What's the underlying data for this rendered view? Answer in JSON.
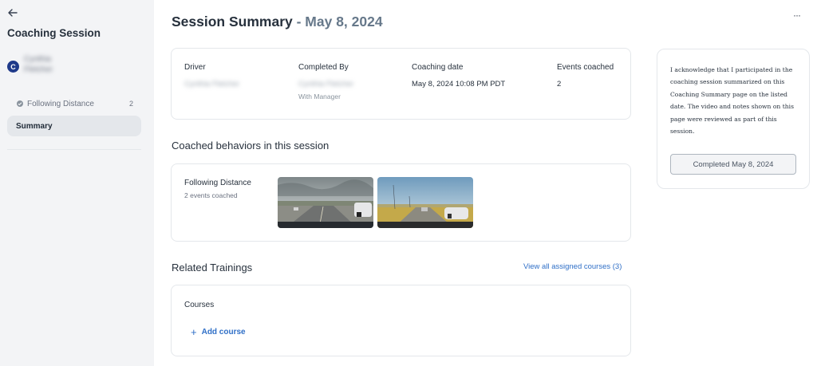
{
  "sidebar": {
    "title": "Coaching Session",
    "avatar_initial": "C",
    "driver_name": "Cynthia Fletcher",
    "items": [
      {
        "label": "Following Distance",
        "count": "2"
      },
      {
        "label": "Summary"
      }
    ]
  },
  "header": {
    "title": "Session Summary",
    "separator": " - ",
    "date": "May 8, 2024",
    "more": "···"
  },
  "info": {
    "driver_label": "Driver",
    "driver_value": "Cynthia Fletcher",
    "completed_by_label": "Completed By",
    "completed_by_value": "Cynthia Fletcher",
    "completed_by_sub": "With Manager",
    "coaching_date_label": "Coaching date",
    "coaching_date_value": "May 8, 2024 10:08 PM PDT",
    "events_label": "Events coached",
    "events_value": "2"
  },
  "behaviors": {
    "section_title": "Coached behaviors in this session",
    "item_title": "Following Distance",
    "item_sub": "2 events coached"
  },
  "trainings": {
    "section_title": "Related Trainings",
    "view_all": "View all assigned courses (3)",
    "courses_label": "Courses",
    "add_course": "Add course"
  },
  "acknowledgement": {
    "text": "I acknowledge that I participated in the coaching session summarized on this Coaching Summary page on the listed date. The video and notes shown on this page were reviewed as part of this session.",
    "button": "Completed May 8, 2024"
  },
  "colors": {
    "link": "#2f6fc7",
    "avatar": "#1f3a8a",
    "sidebar_bg": "#f3f4f6"
  }
}
